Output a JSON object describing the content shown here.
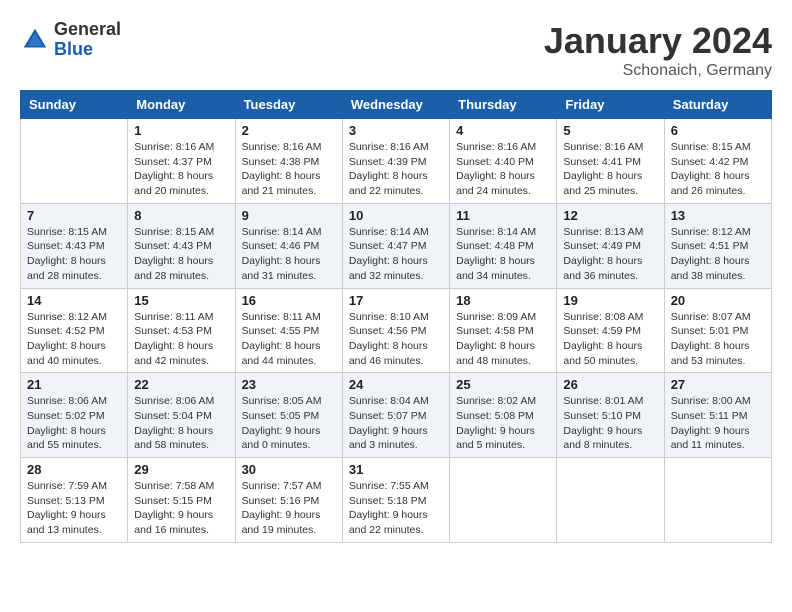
{
  "logo": {
    "general": "General",
    "blue": "Blue"
  },
  "header": {
    "month": "January 2024",
    "location": "Schonaich, Germany"
  },
  "days_of_week": [
    "Sunday",
    "Monday",
    "Tuesday",
    "Wednesday",
    "Thursday",
    "Friday",
    "Saturday"
  ],
  "weeks": [
    [
      {
        "day": "",
        "info": ""
      },
      {
        "day": "1",
        "info": "Sunrise: 8:16 AM\nSunset: 4:37 PM\nDaylight: 8 hours\nand 20 minutes."
      },
      {
        "day": "2",
        "info": "Sunrise: 8:16 AM\nSunset: 4:38 PM\nDaylight: 8 hours\nand 21 minutes."
      },
      {
        "day": "3",
        "info": "Sunrise: 8:16 AM\nSunset: 4:39 PM\nDaylight: 8 hours\nand 22 minutes."
      },
      {
        "day": "4",
        "info": "Sunrise: 8:16 AM\nSunset: 4:40 PM\nDaylight: 8 hours\nand 24 minutes."
      },
      {
        "day": "5",
        "info": "Sunrise: 8:16 AM\nSunset: 4:41 PM\nDaylight: 8 hours\nand 25 minutes."
      },
      {
        "day": "6",
        "info": "Sunrise: 8:15 AM\nSunset: 4:42 PM\nDaylight: 8 hours\nand 26 minutes."
      }
    ],
    [
      {
        "day": "7",
        "info": ""
      },
      {
        "day": "8",
        "info": "Sunrise: 8:15 AM\nSunset: 4:43 PM\nDaylight: 8 hours\nand 28 minutes."
      },
      {
        "day": "9",
        "info": "Sunrise: 8:14 AM\nSunset: 4:46 PM\nDaylight: 8 hours\nand 31 minutes."
      },
      {
        "day": "10",
        "info": "Sunrise: 8:14 AM\nSunset: 4:47 PM\nDaylight: 8 hours\nand 32 minutes."
      },
      {
        "day": "11",
        "info": "Sunrise: 8:14 AM\nSunset: 4:48 PM\nDaylight: 8 hours\nand 34 minutes."
      },
      {
        "day": "12",
        "info": "Sunrise: 8:13 AM\nSunset: 4:49 PM\nDaylight: 8 hours\nand 36 minutes."
      },
      {
        "day": "13",
        "info": "Sunrise: 8:12 AM\nSunset: 4:51 PM\nDaylight: 8 hours\nand 38 minutes."
      }
    ],
    [
      {
        "day": "14",
        "info": ""
      },
      {
        "day": "15",
        "info": "Sunrise: 8:11 AM\nSunset: 4:53 PM\nDaylight: 8 hours\nand 42 minutes."
      },
      {
        "day": "16",
        "info": "Sunrise: 8:11 AM\nSunset: 4:55 PM\nDaylight: 8 hours\nand 44 minutes."
      },
      {
        "day": "17",
        "info": "Sunrise: 8:10 AM\nSunset: 4:56 PM\nDaylight: 8 hours\nand 46 minutes."
      },
      {
        "day": "18",
        "info": "Sunrise: 8:09 AM\nSunset: 4:58 PM\nDaylight: 8 hours\nand 48 minutes."
      },
      {
        "day": "19",
        "info": "Sunrise: 8:08 AM\nSunset: 4:59 PM\nDaylight: 8 hours\nand 50 minutes."
      },
      {
        "day": "20",
        "info": "Sunrise: 8:07 AM\nSunset: 5:01 PM\nDaylight: 8 hours\nand 53 minutes."
      }
    ],
    [
      {
        "day": "21",
        "info": ""
      },
      {
        "day": "22",
        "info": "Sunrise: 8:06 AM\nSunset: 5:04 PM\nDaylight: 8 hours\nand 58 minutes."
      },
      {
        "day": "23",
        "info": "Sunrise: 8:05 AM\nSunset: 5:05 PM\nDaylight: 9 hours\nand 0 minutes."
      },
      {
        "day": "24",
        "info": "Sunrise: 8:04 AM\nSunset: 5:07 PM\nDaylight: 9 hours\nand 3 minutes."
      },
      {
        "day": "25",
        "info": "Sunrise: 8:02 AM\nSunset: 5:08 PM\nDaylight: 9 hours\nand 5 minutes."
      },
      {
        "day": "26",
        "info": "Sunrise: 8:01 AM\nSunset: 5:10 PM\nDaylight: 9 hours\nand 8 minutes."
      },
      {
        "day": "27",
        "info": "Sunrise: 8:00 AM\nSunset: 5:11 PM\nDaylight: 9 hours\nand 11 minutes."
      }
    ],
    [
      {
        "day": "28",
        "info": ""
      },
      {
        "day": "29",
        "info": "Sunrise: 7:58 AM\nSunset: 5:15 PM\nDaylight: 9 hours\nand 16 minutes."
      },
      {
        "day": "30",
        "info": "Sunrise: 7:57 AM\nSunset: 5:16 PM\nDaylight: 9 hours\nand 19 minutes."
      },
      {
        "day": "31",
        "info": "Sunrise: 7:55 AM\nSunset: 5:18 PM\nDaylight: 9 hours\nand 22 minutes."
      },
      {
        "day": "",
        "info": ""
      },
      {
        "day": "",
        "info": ""
      },
      {
        "day": "",
        "info": ""
      }
    ]
  ],
  "week1_day7_info": "Sunrise: 8:15 AM\nSunset: 4:43 PM\nDaylight: 8 hours\nand 28 minutes.",
  "week2_day1_info": "Sunrise: 8:15 AM\nSunset: 4:43 PM\nDaylight: 8 hours\nand 28 minutes.",
  "week3_day1_info": "Sunrise: 8:12 AM\nSunset: 4:52 PM\nDaylight: 8 hours\nand 40 minutes.",
  "week4_day1_info": "Sunrise: 8:06 AM\nSunset: 5:02 PM\nDaylight: 8 hours\nand 55 minutes.",
  "week5_day1_info": "Sunrise: 7:59 AM\nSunset: 5:13 PM\nDaylight: 9 hours\nand 13 minutes."
}
